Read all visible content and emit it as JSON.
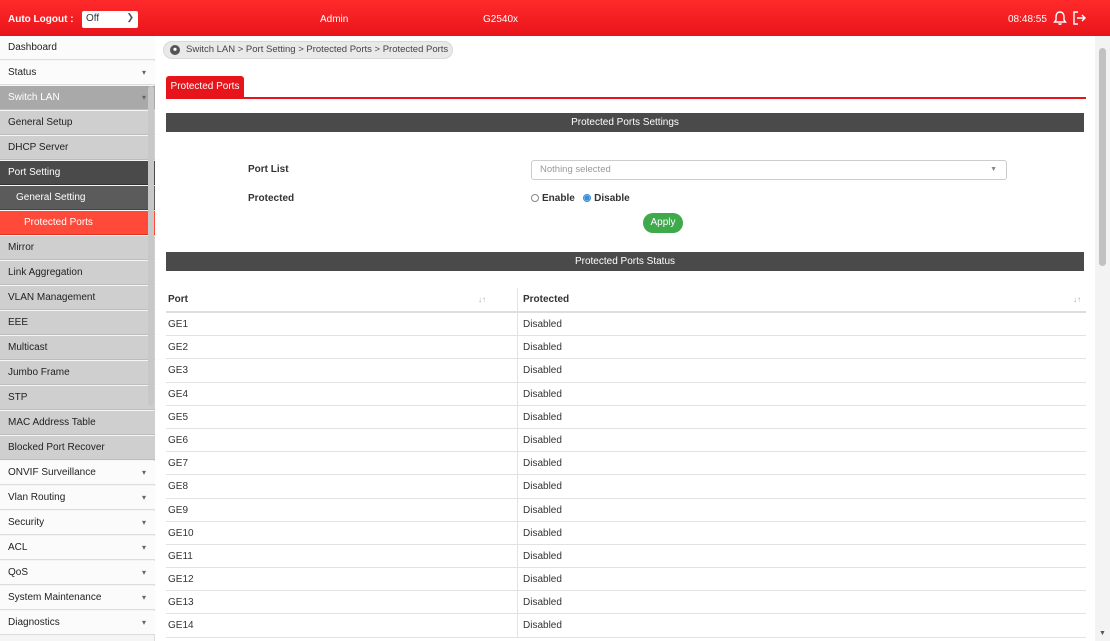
{
  "topbar": {
    "auto_logout_label": "Auto Logout :",
    "auto_logout_value": "Off",
    "user": "Admin",
    "model": "G2540x",
    "time": "08:48:55"
  },
  "sidebar": {
    "items": [
      {
        "label": "Dashboard",
        "arrow": ""
      },
      {
        "label": "Status",
        "arrow": "▾"
      },
      {
        "label": "Switch LAN",
        "arrow": "▾"
      },
      {
        "label": "General Setup",
        "arrow": ""
      },
      {
        "label": "DHCP Server",
        "arrow": ""
      },
      {
        "label": "Port Setting",
        "arrow": ""
      },
      {
        "label": "General Setting",
        "arrow": ""
      },
      {
        "label": "Protected Ports",
        "arrow": ""
      },
      {
        "label": "Mirror",
        "arrow": ""
      },
      {
        "label": "Link Aggregation",
        "arrow": ""
      },
      {
        "label": "VLAN Management",
        "arrow": ""
      },
      {
        "label": "EEE",
        "arrow": ""
      },
      {
        "label": "Multicast",
        "arrow": ""
      },
      {
        "label": "Jumbo Frame",
        "arrow": ""
      },
      {
        "label": "STP",
        "arrow": ""
      },
      {
        "label": "MAC Address Table",
        "arrow": ""
      },
      {
        "label": "Blocked Port Recover",
        "arrow": ""
      },
      {
        "label": "ONVIF Surveillance",
        "arrow": "▾"
      },
      {
        "label": "Vlan Routing",
        "arrow": "▾"
      },
      {
        "label": "Security",
        "arrow": "▾"
      },
      {
        "label": "ACL",
        "arrow": "▾"
      },
      {
        "label": "QoS",
        "arrow": "▾"
      },
      {
        "label": "System Maintenance",
        "arrow": "▾"
      },
      {
        "label": "Diagnostics",
        "arrow": "▾"
      }
    ]
  },
  "breadcrumb": "Switch LAN > Port Setting > Protected Ports > Protected Ports",
  "tab": "Protected Ports",
  "settings": {
    "title": "Protected Ports Settings",
    "port_list_label": "Port List",
    "port_list_placeholder": "Nothing selected",
    "protected_label": "Protected",
    "enable_label": "Enable",
    "disable_label": "Disable",
    "selected": "Disable",
    "apply_label": "Apply"
  },
  "status": {
    "title": "Protected Ports Status",
    "columns": [
      "Port",
      "Protected"
    ],
    "sort_icon": "↓↑",
    "rows": [
      [
        "GE1",
        "Disabled"
      ],
      [
        "GE2",
        "Disabled"
      ],
      [
        "GE3",
        "Disabled"
      ],
      [
        "GE4",
        "Disabled"
      ],
      [
        "GE5",
        "Disabled"
      ],
      [
        "GE6",
        "Disabled"
      ],
      [
        "GE7",
        "Disabled"
      ],
      [
        "GE8",
        "Disabled"
      ],
      [
        "GE9",
        "Disabled"
      ],
      [
        "GE10",
        "Disabled"
      ],
      [
        "GE11",
        "Disabled"
      ],
      [
        "GE12",
        "Disabled"
      ],
      [
        "GE13",
        "Disabled"
      ],
      [
        "GE14",
        "Disabled"
      ]
    ]
  },
  "colors": {
    "brand_red": "#e8141b",
    "active_item": "#ff4a3a",
    "dark_bar": "#4a4a4a",
    "apply_green": "#3faa4b",
    "radio_blue": "#3b8fd9"
  }
}
